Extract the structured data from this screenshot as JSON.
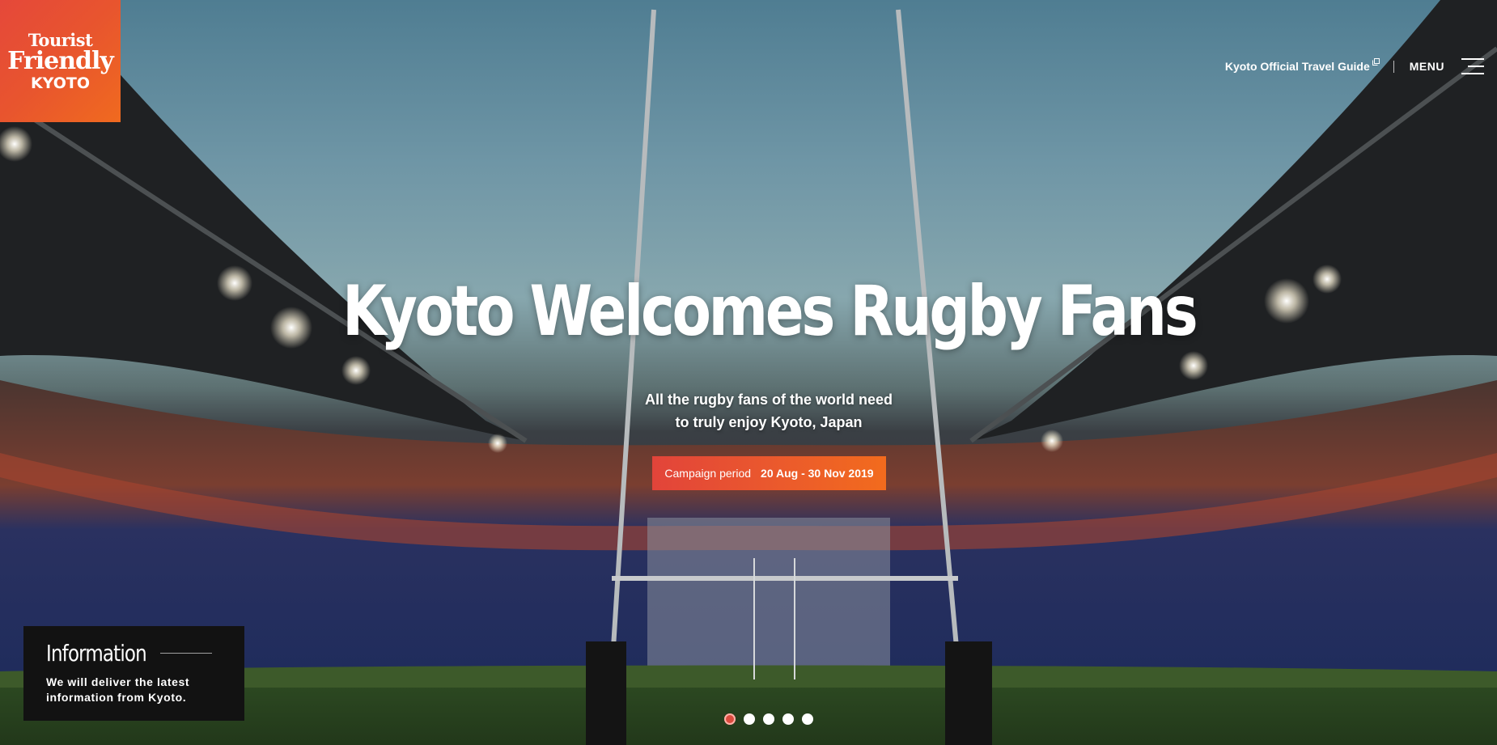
{
  "logo": {
    "line1": "Tourist",
    "line2": "Friendly",
    "line3": "KYOTO"
  },
  "nav": {
    "guide_label": "Kyoto Official Travel Guide",
    "menu_label": "MENU"
  },
  "hero": {
    "title": "Kyoto Welcomes Rugby Fans",
    "subtitle_line1": "All the rugby fans of the world need",
    "subtitle_line2": "to truly enjoy Kyoto, Japan",
    "campaign_label": "Campaign period",
    "campaign_dates": "20 Aug - 30 Nov 2019"
  },
  "info": {
    "title": "Information",
    "text_line1": "We will deliver the latest",
    "text_line2": "information from Kyoto."
  },
  "slider": {
    "total": 5,
    "active_index": 0
  },
  "colors": {
    "brand_red": "#e5483a",
    "brand_orange": "#f06a1f",
    "active_dot": "#dc4b3e"
  }
}
